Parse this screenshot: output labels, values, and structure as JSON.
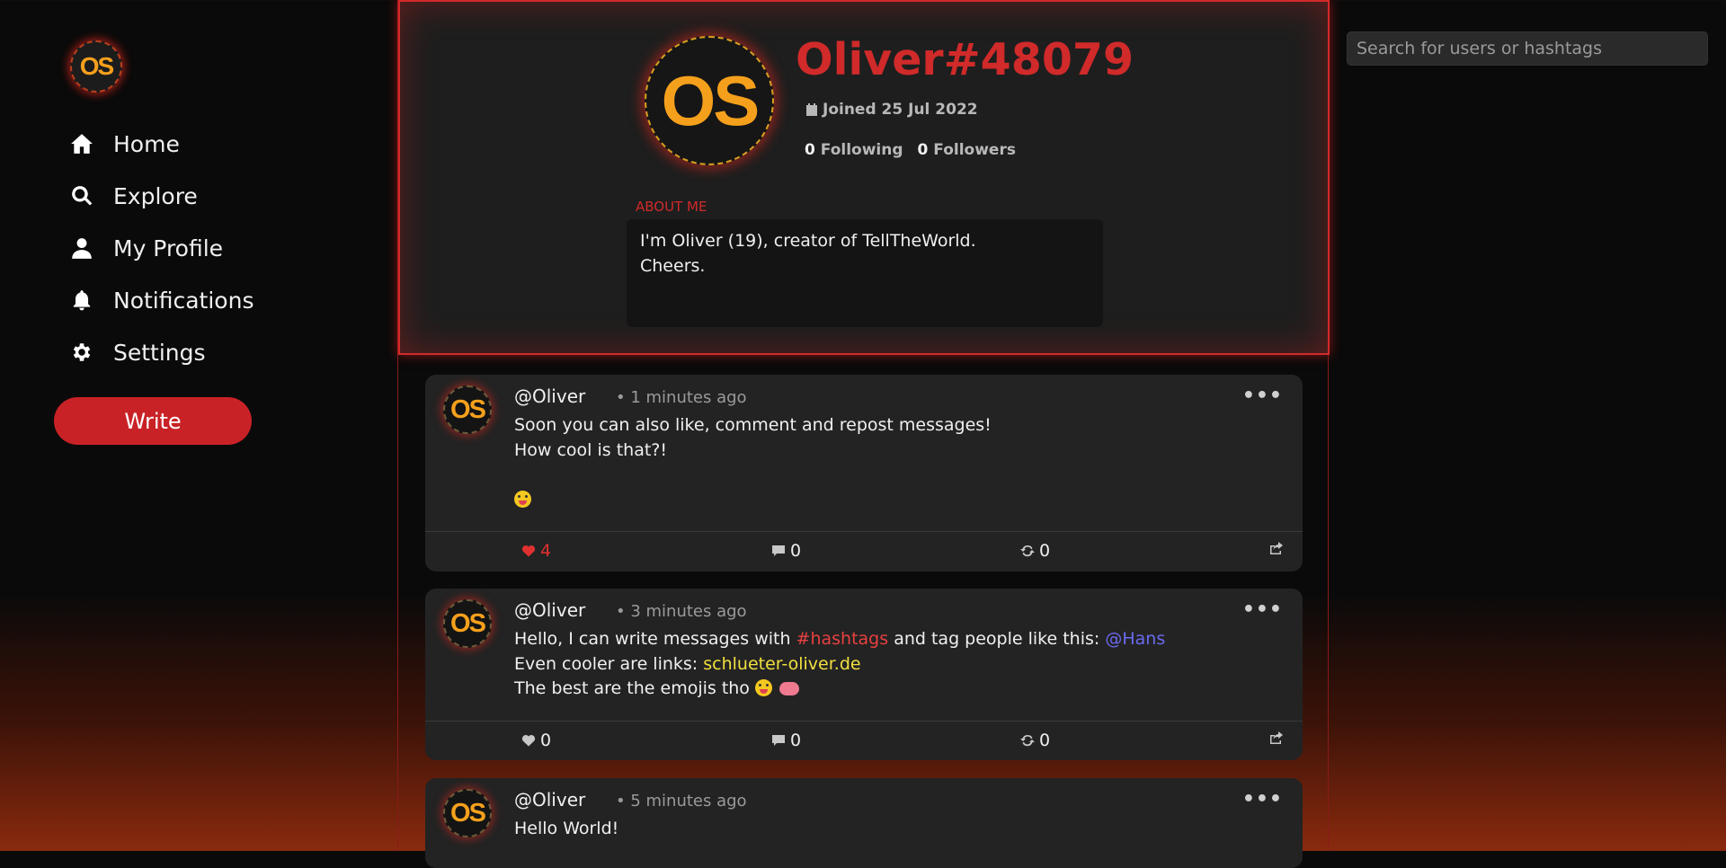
{
  "app": {
    "logo_text": "OS",
    "accent_color": "#c92226"
  },
  "sidebar": {
    "items": [
      {
        "label": "Home",
        "icon": "home-icon"
      },
      {
        "label": "Explore",
        "icon": "search-icon"
      },
      {
        "label": "My Profile",
        "icon": "user-icon"
      },
      {
        "label": "Notifications",
        "icon": "bell-icon"
      },
      {
        "label": "Settings",
        "icon": "gear-icon"
      }
    ],
    "write_label": "Write"
  },
  "profile": {
    "avatar_text": "OS",
    "username": "Oliver#48079",
    "joined": "Joined 25 Jul 2022",
    "following_count": "0",
    "following_label": "Following",
    "followers_count": "0",
    "followers_label": "Followers",
    "about_label": "ABOUT ME",
    "about_lines": [
      "I'm Oliver (19), creator of TellTheWorld.",
      "Cheers."
    ]
  },
  "posts": [
    {
      "avatar_text": "OS",
      "author": "@Oliver",
      "time": "• 1 minutes ago",
      "lines": [
        "Soon you can also like, comment and repost messages!",
        "How cool is that?!",
        "",
        "😛"
      ],
      "likes": "4",
      "comments": "0",
      "reposts": "0",
      "liked": true
    },
    {
      "avatar_text": "OS",
      "author": "@Oliver",
      "time": "• 3 minutes ago",
      "line1_prefix": "Hello, I can write messages with ",
      "line1_tag": "#hashtags",
      "line1_mid": " and tag people like this: ",
      "line1_mention": "@Hans",
      "line2_prefix": "Even cooler are links: ",
      "line2_link": "schlueter-oliver.de",
      "line3_prefix": "The best are the emojis tho ",
      "likes": "0",
      "comments": "0",
      "reposts": "0",
      "liked": false
    },
    {
      "avatar_text": "OS",
      "author": "@Oliver",
      "time": "• 5 minutes ago",
      "lines": [
        "Hello World!"
      ]
    }
  ],
  "more_label": "•••",
  "search": {
    "placeholder": "Search for users or hashtags"
  }
}
